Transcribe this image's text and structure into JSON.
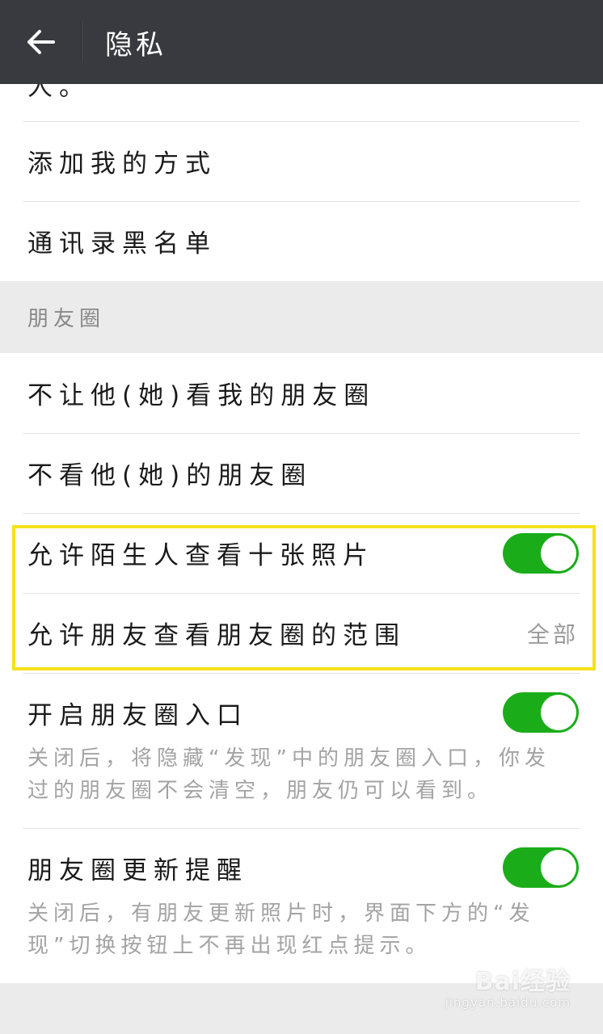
{
  "header": {
    "title": "隐私",
    "back_icon": "arrow-left-icon"
  },
  "contacts_section": {
    "truncated_text": "人。",
    "items": [
      {
        "label": "添加我的方式"
      },
      {
        "label": "通讯录黑名单"
      }
    ]
  },
  "moments_section": {
    "header": "朋友圈",
    "items": [
      {
        "label": "不让他(她)看我的朋友圈"
      },
      {
        "label": "不看他(她)的朋友圈"
      },
      {
        "label": "允许陌生人查看十张照片",
        "toggle": true
      },
      {
        "label": "允许朋友查看朋友圈的范围",
        "value": "全部"
      },
      {
        "label": "开启朋友圈入口",
        "toggle": true,
        "description": "关闭后，将隐藏“发现”中的朋友圈入口，你发过的朋友圈不会清空，朋友仍可以看到。"
      },
      {
        "label": "朋友圈更新提醒",
        "toggle": true,
        "description": "关闭后，有朋友更新照片时，界面下方的“发现”切换按钮上不再出现红点提示。"
      }
    ]
  },
  "colors": {
    "topbar": "#393a3f",
    "toggle_on": "#1aad19",
    "highlight_border": "#f5e11c"
  },
  "watermark": {
    "brand": "Bai经验",
    "url": "jingyan.baidu.com"
  }
}
